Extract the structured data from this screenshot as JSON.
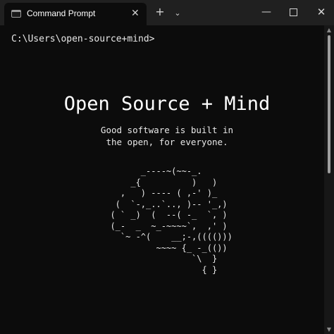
{
  "window": {
    "tab_title": "Command Prompt",
    "tab_close_glyph": "✕",
    "new_tab_glyph": "+",
    "dropdown_glyph": "⌄",
    "minimize_glyph": "—",
    "close_glyph": "✕"
  },
  "terminal": {
    "prompt": "C:\\Users\\open-source+mind>",
    "banner_title": "Open Source + Mind",
    "banner_subtitle_lines": [
      "Good software is built in",
      "the open, for everyone."
    ],
    "ascii_art": "        _----~(~~-_.\n      _{          )   )\n    ,   ) ---- ( ,-' )_\n   (  `-,_..`.., )-- '_,)\n  ( ` _)  (  --( -_  `, )\n  (_-  _  ~_-~~~~`,  ,' )\n    `~ -^(    __;-,(((()))\n           ~~~~ {_ -_(())\n                  `\\  }\n                    { }"
  },
  "icons": {
    "tab_icon": "terminal-icon",
    "scroll_up": "chevron-up-icon",
    "scroll_down": "chevron-down-icon"
  },
  "colors": {
    "terminal_bg": "#0c0c0c",
    "titlebar_bg": "#202020",
    "text": "#f2f2f2"
  }
}
